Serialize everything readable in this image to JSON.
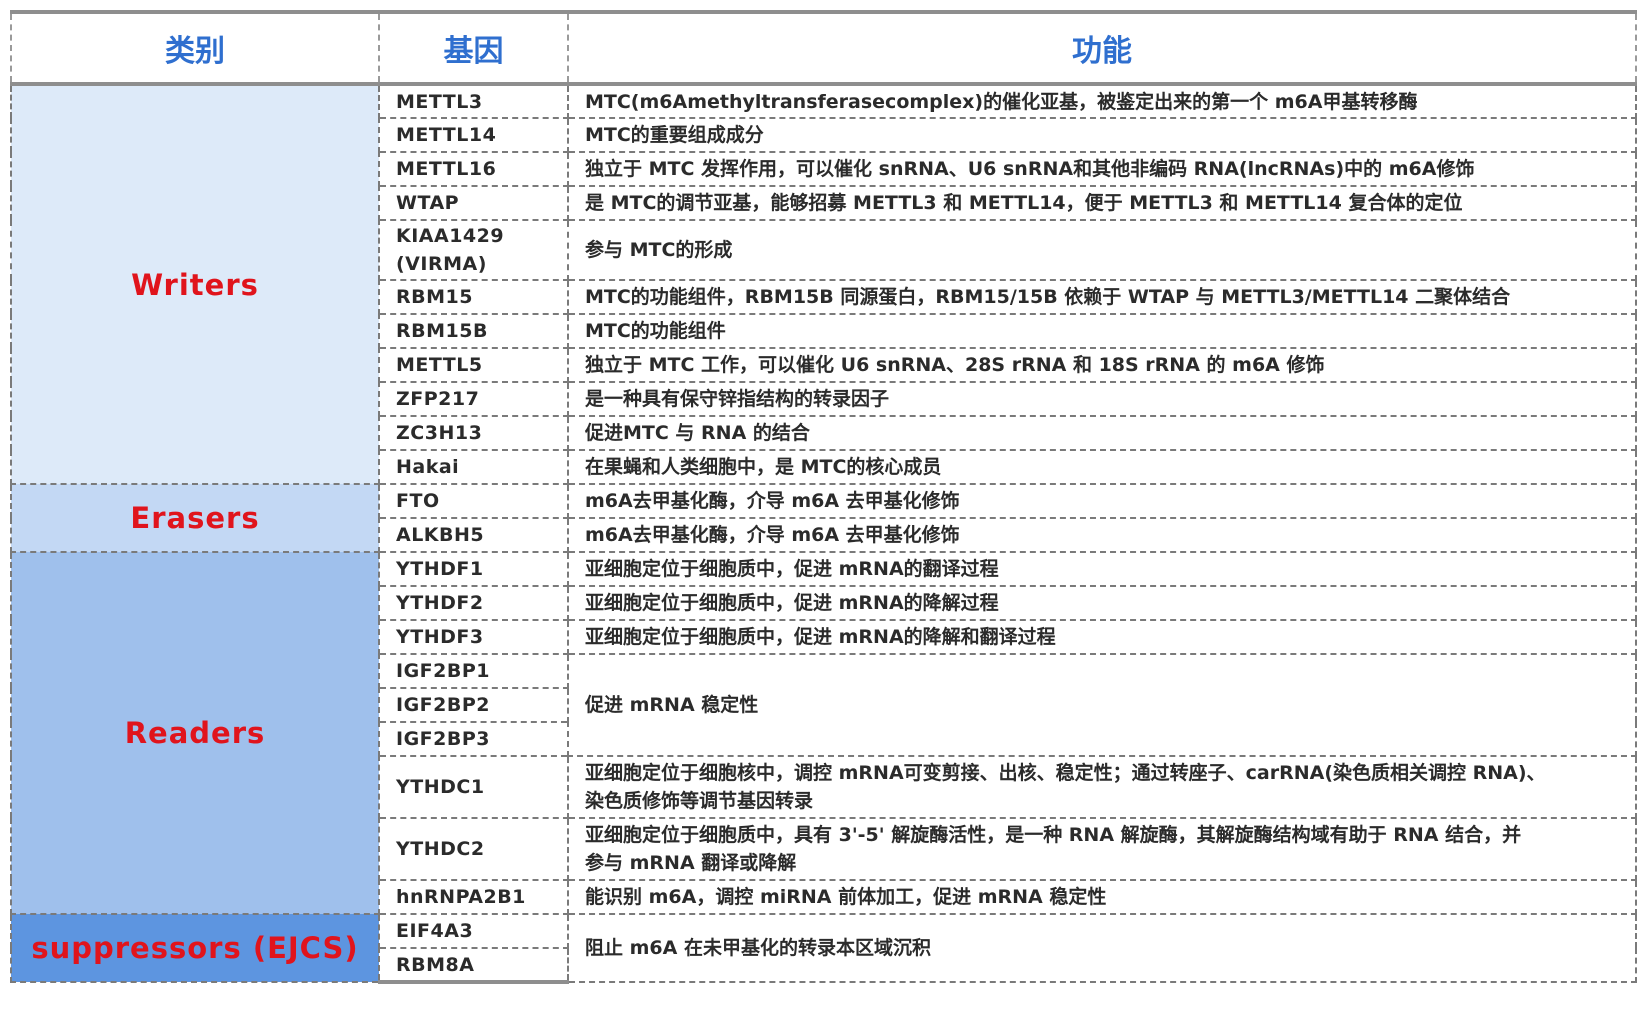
{
  "header": {
    "category": "类别",
    "gene": "基因",
    "function": "功能"
  },
  "colors": {
    "header_text": "#2f6fcf",
    "category_text": "#e0141c",
    "writers_bg": "#ddeaf9",
    "erasers_bg": "#c3d8f4",
    "readers_bg": "#9fc0ec",
    "suppressors_bg": "#5d95e0"
  },
  "groups": [
    {
      "category": "Writers",
      "rows": [
        {
          "gene": "METTL3",
          "func": "MTC(m6Amethyltransferasecomplex)的催化亚基，被鉴定出来的第一个 m6A甲基转移酶"
        },
        {
          "gene": "METTL14",
          "func": "MTC的重要组成成分"
        },
        {
          "gene": "METTL16",
          "func": "独立于 MTC 发挥作用，可以催化 snRNA、U6 snRNA和其他非编码 RNA(lncRNAs)中的 m6A修饰"
        },
        {
          "gene": "WTAP",
          "func": "是 MTC的调节亚基，能够招募 METTL3 和 METTL14，便于 METTL3 和 METTL14 复合体的定位"
        },
        {
          "gene": "KIAA1429",
          "gene2": "(VIRMA)",
          "func": "参与 MTC的形成"
        },
        {
          "gene": "RBM15",
          "func": "MTC的功能组件，RBM15B 同源蛋白，RBM15/15B 依赖于 WTAP 与 METTL3/METTL14 二聚体结合"
        },
        {
          "gene": "RBM15B",
          "func": "MTC的功能组件"
        },
        {
          "gene": "METTL5",
          "func": "独立于 MTC 工作，可以催化 U6 snRNA、28S rRNA 和 18S rRNA 的 m6A 修饰"
        },
        {
          "gene": "ZFP217",
          "func": "是一种具有保守锌指结构的转录因子"
        },
        {
          "gene": "ZC3H13",
          "func": "促进MTC 与 RNA 的结合"
        },
        {
          "gene": "Hakai",
          "func": "在果蝇和人类细胞中，是 MTC的核心成员"
        }
      ]
    },
    {
      "category": "Erasers",
      "rows": [
        {
          "gene": "FTO",
          "func": "m6A去甲基化酶，介导 m6A 去甲基化修饰"
        },
        {
          "gene": "ALKBH5",
          "func": "m6A去甲基化酶，介导 m6A 去甲基化修饰"
        }
      ]
    },
    {
      "category": "Readers",
      "rows": [
        {
          "gene": "YTHDF1",
          "func": "亚细胞定位于细胞质中，促进 mRNA的翻译过程"
        },
        {
          "gene": "YTHDF2",
          "func": "亚细胞定位于细胞质中，促进 mRNA的降解过程"
        },
        {
          "gene": "YTHDF3",
          "func": "亚细胞定位于细胞质中，促进 mRNA的降解和翻译过程"
        },
        {
          "gene": "IGF2BP1",
          "func": "促进 mRNA 稳定性"
        },
        {
          "gene": "IGF2BP2"
        },
        {
          "gene": "IGF2BP3"
        },
        {
          "gene": "YTHDC1",
          "func": "亚细胞定位于细胞核中，调控 mRNA可变剪接、出核、稳定性；通过转座子、carRNA(染色质相关调控 RNA)、",
          "func2": "染色质修饰等调节基因转录"
        },
        {
          "gene": "YTHDC2",
          "func": "亚细胞定位于细胞质中，具有 3'-5' 解旋酶活性，是一种 RNA 解旋酶，其解旋酶结构域有助于 RNA 结合，并",
          "func2": "参与 mRNA 翻译或降解"
        },
        {
          "gene": "hnRNPA2B1",
          "func": "能识别 m6A，调控 miRNA 前体加工，促进 mRNA 稳定性"
        }
      ]
    },
    {
      "category": "suppressors (EJCS)",
      "rows": [
        {
          "gene": "EIF4A3",
          "func": "阻止 m6A 在未甲基化的转录本区域沉积"
        },
        {
          "gene": "RBM8A"
        }
      ]
    }
  ]
}
